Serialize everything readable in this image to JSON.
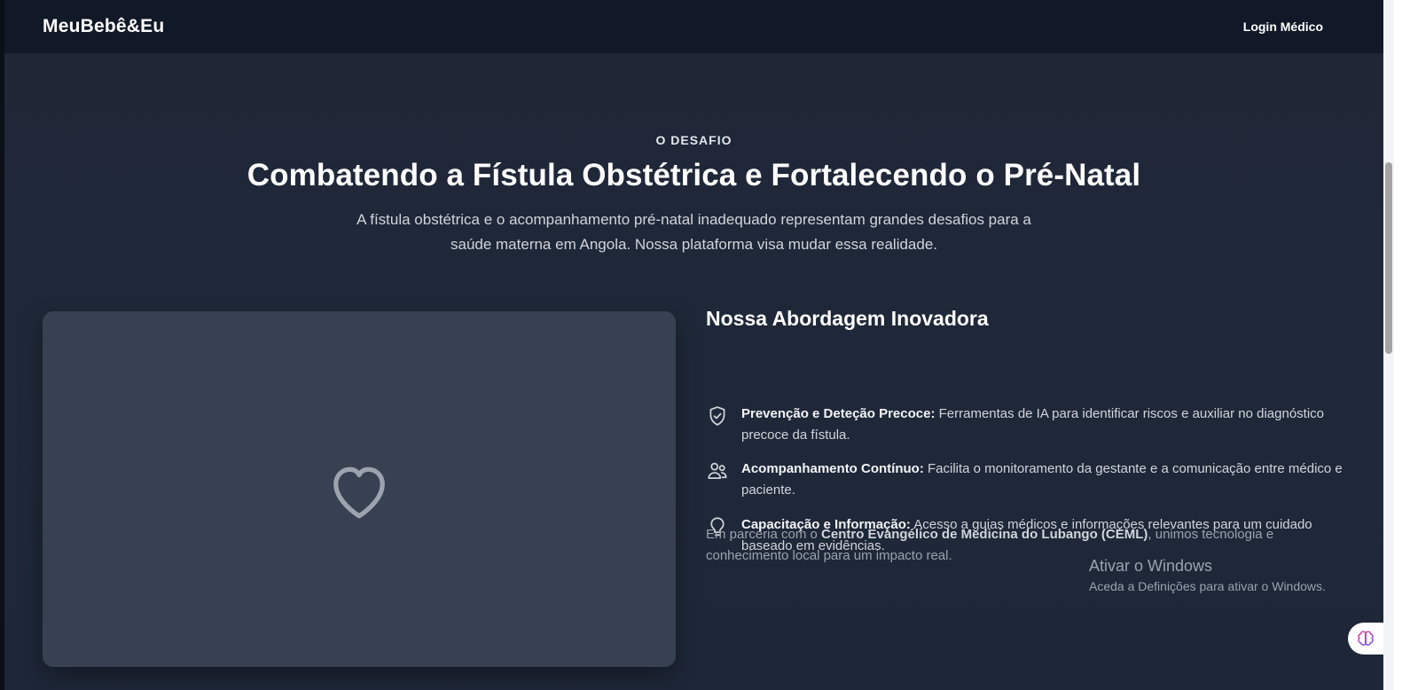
{
  "nav": {
    "brand": "MeuBebê&Eu",
    "login": "Login Médico"
  },
  "hero": {
    "eyebrow": "O DESAFIO",
    "title": "Combatendo a Fístula Obstétrica e Fortalecendo o Pré-Natal",
    "subtitle": "A fístula obstétrica e o acompanhamento pré-natal inadequado representam grandes desafios para a saúde materna em Angola. Nossa plataforma visa mudar essa realidade."
  },
  "image_card": {
    "icon": "heart-icon"
  },
  "approach": {
    "title": "Nossa Abordagem Inovadora",
    "features": [
      {
        "icon": "shield-check-icon",
        "title": "Prevenção e Deteção Precoce:",
        "text": " Ferramentas de IA para identificar riscos e auxiliar no diagnóstico precoce da fístula."
      },
      {
        "icon": "users-icon",
        "title": "Acompanhamento Contínuo:",
        "text": " Facilita o monitoramento da gestante e a comunicação entre médico e paciente."
      },
      {
        "icon": "lightbulb-icon",
        "title": "Capacitação e Informação:",
        "text": " Acesso a guias médicos e informações relevantes para um cuidado baseado em evidências."
      }
    ],
    "partner_prefix": "Em parceria com o ",
    "partner_name": "Centro Evangélico de Medicina do Lubango (CEML)",
    "partner_suffix": ", unimos tecnologia e conhecimento local para um impacto real."
  },
  "windows_watermark": {
    "title": "Ativar o Windows",
    "subtitle": "Aceda a Definições para ativar o Windows."
  },
  "colors": {
    "background": "#1f2737",
    "navbar": "#111827",
    "card": "#374151",
    "text": "#e5e7eb"
  }
}
